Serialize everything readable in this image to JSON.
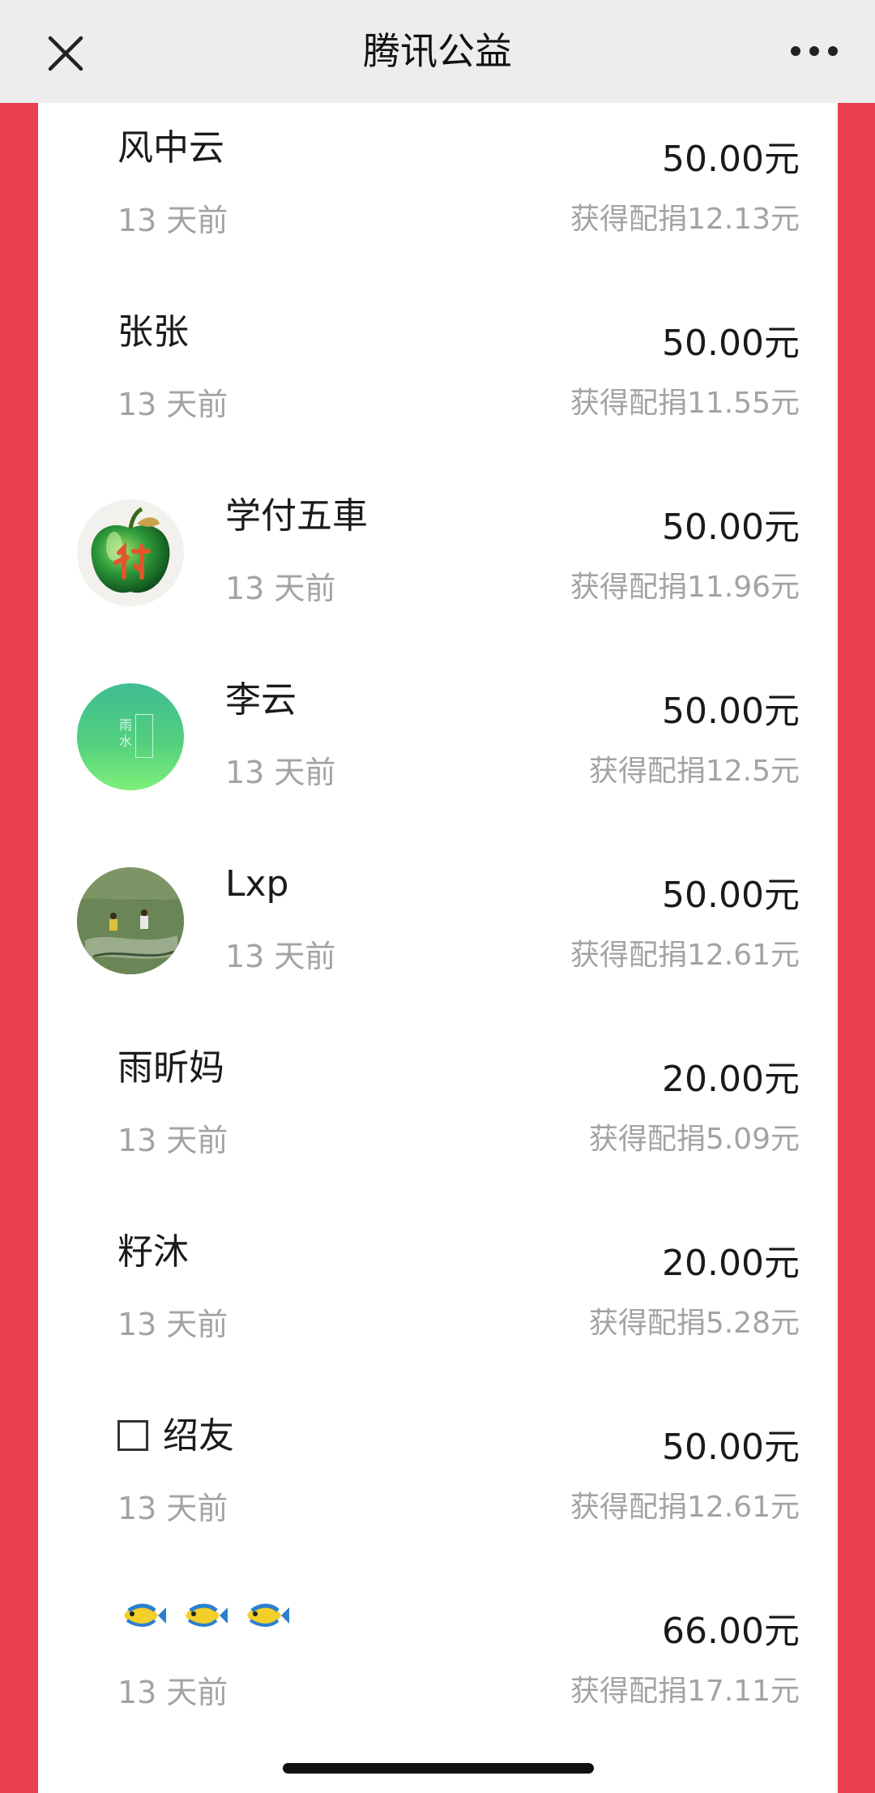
{
  "header": {
    "title": "腾讯公益",
    "close_icon": "close-icon",
    "more_icon": "more-dots-icon"
  },
  "colors": {
    "page_background": "#e8404c",
    "header_background": "#ededed",
    "panel_background": "#ffffff",
    "secondary_text": "#a3a3a3"
  },
  "donations": [
    {
      "name": "风中云",
      "time": "13 天前",
      "amount": "50.00元",
      "match": "获得配捐12.13元",
      "avatar": "none"
    },
    {
      "name": "张张",
      "time": "13 天前",
      "amount": "50.00元",
      "match": "获得配捐11.55元",
      "avatar": "none"
    },
    {
      "name": "学付五車",
      "time": "13 天前",
      "amount": "50.00元",
      "match": "获得配捐11.96元",
      "avatar": "green-apple-avatar"
    },
    {
      "name": "李云",
      "time": "13 天前",
      "amount": "50.00元",
      "match": "获得配捐12.5元",
      "avatar": "green-gradient-avatar"
    },
    {
      "name": "Lxp",
      "time": "13 天前",
      "amount": "50.00元",
      "match": "获得配捐12.61元",
      "avatar": "landscape-photo-avatar"
    },
    {
      "name": "雨昕妈",
      "time": "13 天前",
      "amount": "20.00元",
      "match": "获得配捐5.09元",
      "avatar": "none"
    },
    {
      "name": "籽沐",
      "time": "13 天前",
      "amount": "20.00元",
      "match": "获得配捐5.28元",
      "avatar": "none"
    },
    {
      "name": "绍友",
      "time": "13 天前",
      "amount": "50.00元",
      "match": "获得配捐12.61元",
      "avatar": "none",
      "name_prefix_icon": "checkbox-icon"
    },
    {
      "name": "",
      "time": "13 天前",
      "amount": "66.00元",
      "match": "获得配捐17.11元",
      "avatar": "none",
      "name_icons": [
        "fish-emoji-icon",
        "fish-emoji-icon",
        "fish-emoji-icon"
      ]
    }
  ],
  "avatar_labels": {
    "green_gradient": "雨水"
  }
}
